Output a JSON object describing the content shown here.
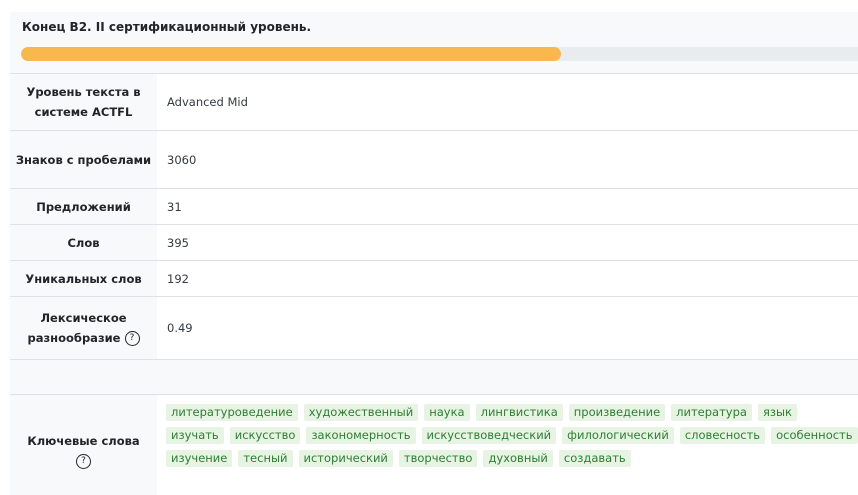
{
  "level": {
    "title": "Конец B2. II сертификационный уровень.",
    "progress_fraction": 0.645,
    "progress_color": "#f8b84e"
  },
  "stats": {
    "actfl_label": "Уровень текста в системе ACTFL",
    "actfl_value": "Advanced Mid",
    "chars_label": "Знаков с пробелами",
    "chars_value": "3060",
    "sentences_label": "Предложений",
    "sentences_value": "31",
    "words_label": "Слов",
    "words_value": "395",
    "unique_label": "Уникальных слов",
    "unique_value": "192",
    "lexical_label": "Лексическое разнообразие",
    "lexical_value": "0.49",
    "keywords_label": "Ключевые слова",
    "help_icon": "question-circle-icon"
  },
  "keywords": [
    "литературоведение",
    "художественный",
    "наука",
    "лингвистика",
    "произведение",
    "литература",
    "язык",
    "изучать",
    "искусство",
    "закономерность",
    "искусствоведческий",
    "филологический",
    "словесность",
    "особенность",
    "изучение",
    "тесный",
    "исторический",
    "творчество",
    "духовный",
    "создавать"
  ],
  "colors": {
    "keyword_bg": "#e7f4e4",
    "keyword_text": "#2e7d32",
    "progress_track": "#e9ecef"
  }
}
